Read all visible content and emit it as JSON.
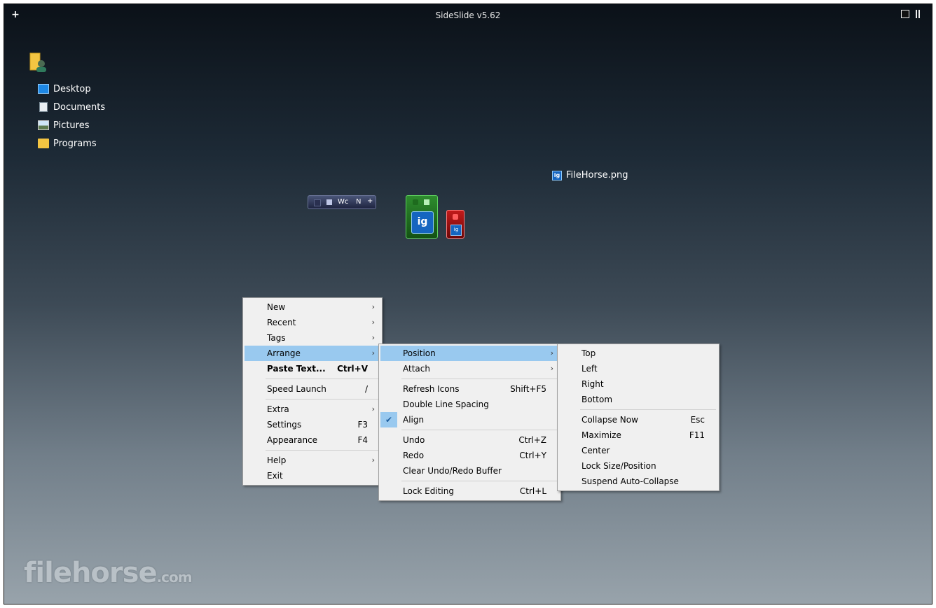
{
  "window": {
    "title": "SideSlide v5.62",
    "plus": "+"
  },
  "nav": [
    {
      "label": "Desktop",
      "icon": "desktop-icon"
    },
    {
      "label": "Documents",
      "icon": "document-icon"
    },
    {
      "label": "Pictures",
      "icon": "picture-icon"
    },
    {
      "label": "Programs",
      "icon": "folder-icon"
    }
  ],
  "file_item": {
    "label": "FileHorse.png",
    "icon": "ig"
  },
  "mini_bar": {
    "label": "Wc",
    "n": "N",
    "plus": "+"
  },
  "green_dock": {
    "icon_text": "ig"
  },
  "red_dock": {
    "icon_text": "ig"
  },
  "watermark": {
    "main": "filehorse",
    "suffix": ".com"
  },
  "menu_main": {
    "new": "New",
    "recent": "Recent",
    "tags": "Tags",
    "arrange": "Arrange",
    "paste": "Paste Text...",
    "paste_sc": "Ctrl+V",
    "speed": "Speed Launch",
    "speed_sc": "/",
    "extra": "Extra",
    "settings": "Settings",
    "settings_sc": "F3",
    "appearance": "Appearance",
    "appearance_sc": "F4",
    "help": "Help",
    "exit": "Exit"
  },
  "menu_arrange": {
    "position": "Position",
    "attach": "Attach",
    "refresh": "Refresh Icons",
    "refresh_sc": "Shift+F5",
    "double": "Double Line Spacing",
    "align": "Align",
    "undo": "Undo",
    "undo_sc": "Ctrl+Z",
    "redo": "Redo",
    "redo_sc": "Ctrl+Y",
    "clear": "Clear Undo/Redo Buffer",
    "lock": "Lock Editing",
    "lock_sc": "Ctrl+L"
  },
  "menu_position": {
    "top": "Top",
    "left": "Left",
    "right": "Right",
    "bottom": "Bottom",
    "collapse": "Collapse Now",
    "collapse_sc": "Esc",
    "maximize": "Maximize",
    "maximize_sc": "F11",
    "center": "Center",
    "lock": "Lock Size/Position",
    "suspend": "Suspend Auto-Collapse"
  },
  "colors": {
    "highlight": "#99c9ef",
    "menu_bg": "#f0f0f0"
  }
}
